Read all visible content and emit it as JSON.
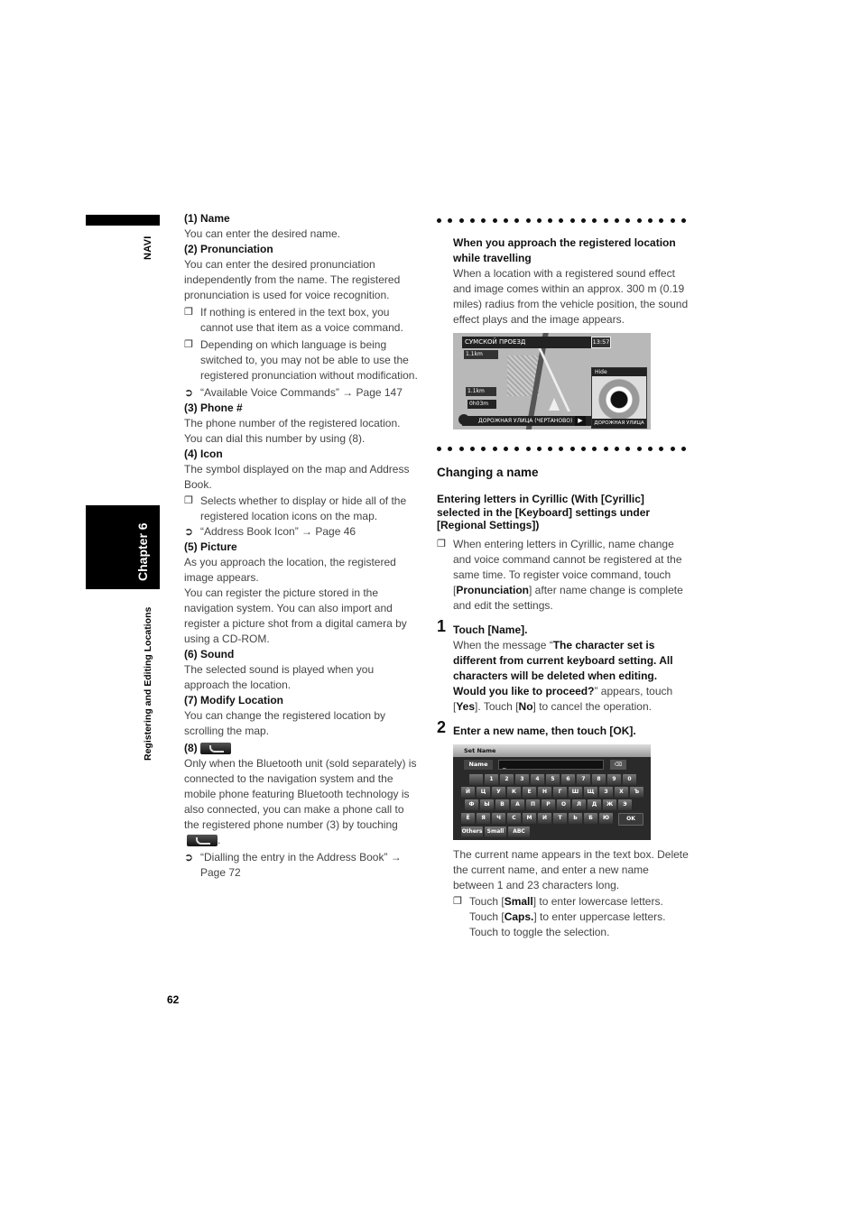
{
  "sidebar": {
    "section": "NAVI",
    "chapter": "Chapter 6",
    "chapter_title": "Registering and Editing Locations"
  },
  "page_number": "62",
  "left_column": {
    "items": [
      {
        "heading": "(1) Name",
        "text": "You can enter the desired name."
      },
      {
        "heading": "(2) Pronunciation",
        "text": "You can enter the desired pronunciation independently from the name. The registered pronunciation is used for voice recognition."
      }
    ],
    "pron_notes": [
      "If nothing is entered in the text box, you cannot use that item as a voice command.",
      "Depending on which language is being switched to, you may not be able to use the registered pronunciation without modification."
    ],
    "pron_ref": "“Available Voice Commands” → Page 147",
    "phone": {
      "heading": "(3) Phone #",
      "text": "The phone number of the registered location. You can dial this number by using (8)."
    },
    "icon": {
      "heading": "(4) Icon",
      "text": "The symbol displayed on the map and Address Book.",
      "note": "Selects whether to display or hide all of the registered location icons on the map.",
      "ref": "“Address Book Icon” → Page 46"
    },
    "picture": {
      "heading": "(5) Picture",
      "text1": "As you approach the location, the registered image appears.",
      "text2": "You can register the picture stored in the navigation system. You can also import and register a picture shot from a digital camera by using a CD-ROM."
    },
    "sound": {
      "heading": "(6) Sound",
      "text": "The selected sound is played when you approach the location."
    },
    "modify": {
      "heading": "(7) Modify Location",
      "text": "You can change the registered location by scrolling the map."
    },
    "call": {
      "heading": "(8)",
      "text_before": "Only when the Bluetooth unit (sold separately) is connected to the navigation system and the mobile phone featuring Bluetooth technology is also connected, you can make a phone call to the registered phone number (3) by touching",
      "text_after": ".",
      "ref": "“Dialling the entry in the Address Book” → Page 72",
      "icon": "phone-call-icon"
    }
  },
  "right_column": {
    "approach": {
      "heading": "When you approach the registered location while travelling",
      "text": "When a location with a registered sound effect and image comes within an approx. 300 m (0.19 miles) radius from the vehicle position, the sound effect plays and the image appears."
    },
    "map_screen": {
      "street_top": "СУМСКОЙ ПРОЕЗД",
      "time": "13:57",
      "dist_next": "1.1km",
      "dist_remaining": "1.1km",
      "eta": "0h03m",
      "current_street": "ДОРОЖНАЯ УЛИЦА (ЧЕРТАНОВО)",
      "popup_hide": "Hide",
      "popup_caption": "ДОРОЖНАЯ УЛИЦА"
    },
    "changing": {
      "title": "Changing a name",
      "subtitle": "Entering letters in Cyrillic (With [Cyrillic] selected in the [Keyboard] settings under [Regional Settings])",
      "note_before": "When entering letters in Cyrillic, name change and voice command cannot be registered at the same time. To register voice command, touch [",
      "note_bold": "Pronunciation",
      "note_after": "] after name change is complete and edit the settings."
    },
    "step1": {
      "num": "1",
      "title": "Touch [Name].",
      "t1": "When the message “",
      "msg": "The character set is different from current keyboard setting. All characters will be deleted when editing. Would you like to proceed?",
      "t2": "” appears, touch [",
      "yes": "Yes",
      "t3": "]. Touch [",
      "no": "No",
      "t4": "] to cancel the operation."
    },
    "step2": {
      "num": "2",
      "title": "Enter a new name, then touch [OK]."
    },
    "keyboard_screen": {
      "title": "Set Name",
      "name_label": "Name",
      "name_value": "_",
      "backspace": "⌫",
      "rows": [
        [
          "",
          "1",
          "2",
          "3",
          "4",
          "5",
          "6",
          "7",
          "8",
          "9",
          "0"
        ],
        [
          "Й",
          "Ц",
          "У",
          "К",
          "Е",
          "Н",
          "Г",
          "Ш",
          "Щ",
          "З",
          "Х",
          "Ъ"
        ],
        [
          "Ф",
          "Ы",
          "В",
          "А",
          "П",
          "Р",
          "О",
          "Л",
          "Д",
          "Ж",
          "Э"
        ],
        [
          "Ё",
          "Я",
          "Ч",
          "С",
          "М",
          "И",
          "Т",
          "Ь",
          "Б",
          "Ю"
        ]
      ],
      "ok": "OK",
      "bottom": [
        "Others",
        "Small",
        "ABC"
      ]
    },
    "after_kbd": "The current name appears in the text box. Delete the current name, and enter a new name between 1 and 23 characters long.",
    "case_note": {
      "t1": "Touch [",
      "small": "Small",
      "t2": "] to enter lowercase letters. Touch [",
      "caps": "Caps.",
      "t3": "] to enter uppercase letters. Touch to toggle the selection."
    }
  }
}
